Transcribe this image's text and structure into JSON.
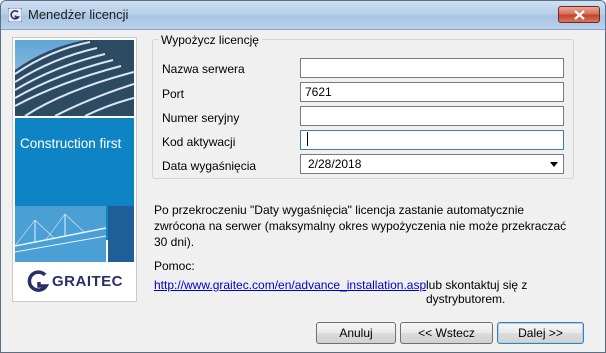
{
  "window": {
    "title": "Menedżer licencji"
  },
  "side_panel": {
    "banner_text": "Construction first",
    "logo_text": "GRAITEC"
  },
  "form": {
    "group_title": "Wypożycz licencję",
    "server_label": "Nazwa serwera",
    "server_value": "",
    "port_label": "Port",
    "port_value": "7621",
    "serial_label": "Numer seryjny",
    "serial_value": "",
    "activation_label": "Kod aktywacji",
    "activation_value": "",
    "expiry_label": "Data wygaśnięcia",
    "expiry_value": "2/28/2018"
  },
  "info_text": "Po przekroczeniu \"Daty wygaśnięcia\" licencja zastanie automatycznie zwrócona na serwer (maksymalny okres wypożyczenia nie może przekraczać 30 dni).",
  "help": {
    "label": "Pomoc:",
    "link": "http://www.graitec.com/en/advance_installation.asp",
    "contact": "lub skontaktuj się z dystrybutorem."
  },
  "buttons": {
    "cancel": "Anuluj",
    "back": "<< Wstecz",
    "next": "Dalej >>"
  },
  "colors": {
    "banner_blue": "#0f84c4",
    "link": "#0000cc"
  }
}
